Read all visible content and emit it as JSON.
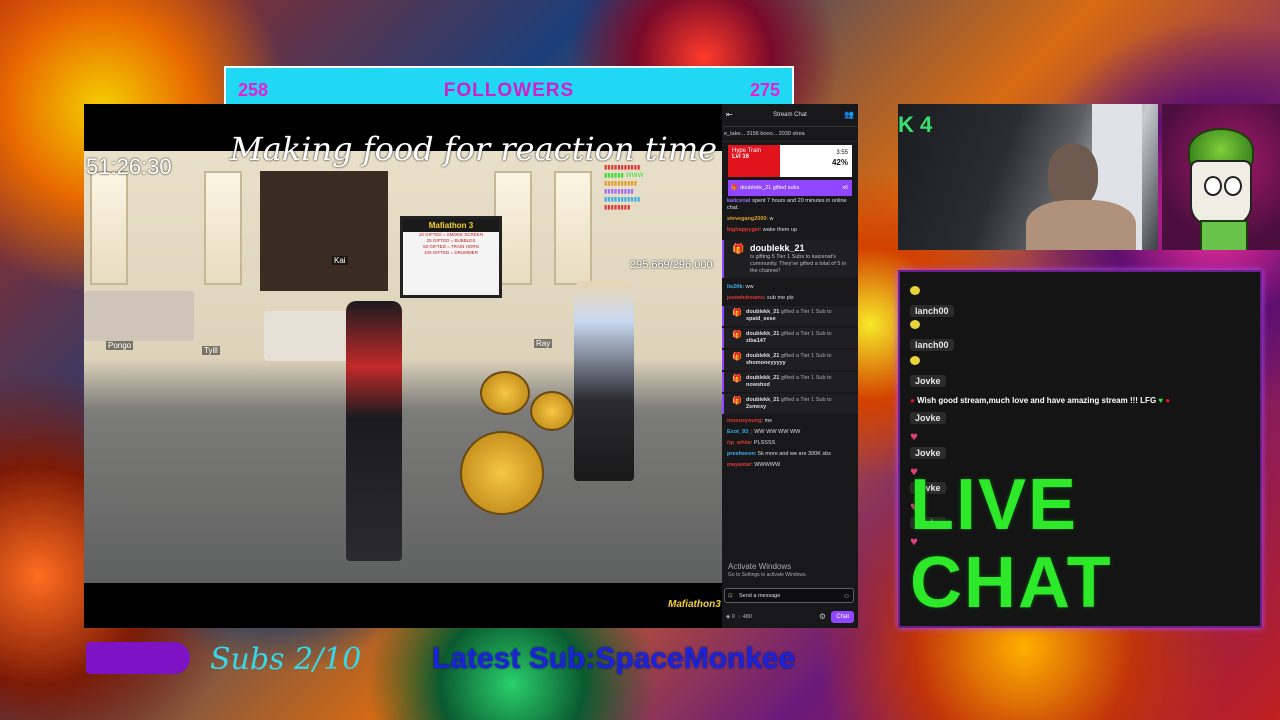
{
  "followers": {
    "current": "258",
    "label": "FOLLOWERS",
    "goal": "275"
  },
  "stream": {
    "title_overlay": "Making food for reaction time",
    "timer": "51:26:30",
    "counter": "295.669/296.000",
    "tv_title": "Mafiathon 3",
    "tv_lines": [
      "10 GIFTED = SMOKE SCREEN",
      "25 GIFTED = BUBBLES",
      "50 GIFTED = TRAIN HORN",
      "100 GIFTED = DRUMMER"
    ],
    "name_tags": [
      "Tyill",
      "Kai",
      "Ray",
      "Pongo"
    ],
    "corner_logo": "Mafiathon3"
  },
  "twitch_chat": {
    "header": "Stream Chat",
    "top_row": "e_take... 3156   booo... 2030   strea",
    "hype_train": {
      "label": "Hype Train",
      "level": "Lvl 16",
      "time": "3:55",
      "percent": "42%"
    },
    "gift_bar": {
      "text": "doublekk_21 gifted subs",
      "count": "x6"
    },
    "messages_top": [
      {
        "user": "kaiicenat",
        "text": "spent 7 hours and 20 minutes in online chat.",
        "color": "#9f6bff"
      },
      {
        "user": "stevegang2000",
        "text": "w",
        "color": "#e0a030"
      },
      {
        "user": "bighappyget",
        "text": "wake them up",
        "color": "#e03838"
      }
    ],
    "big_gift": {
      "user": "doublekk_21",
      "text": "is gifting 5 Tier 1 Subs to kaicenat's community. They've gifted a total of 5 in the channel!"
    },
    "messages_mid": [
      {
        "user": "lix2tlk",
        "text": "ww",
        "color": "#3bb0e8"
      },
      {
        "user": "justwhdreams",
        "text": "sub me pls",
        "color": "#e03838"
      }
    ],
    "gifts": [
      {
        "user": "doublekk_21",
        "text": "gifted a Tier 1 Sub to",
        "target": "spaid_sese"
      },
      {
        "user": "doublekk_21",
        "text": "gifted a Tier 1 Sub to",
        "target": "ziba147"
      },
      {
        "user": "doublekk_21",
        "text": "gifted a Tier 1 Sub to",
        "target": "shomoneyyyyy"
      },
      {
        "user": "doublekk_21",
        "text": "gifted a Tier 1 Sub to",
        "target": "nowshxd"
      },
      {
        "user": "doublekk_21",
        "text": "gifted a Tier 1 Sub to",
        "target": "2smexy"
      }
    ],
    "messages_bottom": [
      {
        "user": "mooneyoung",
        "text": "me",
        "color": "#e03838"
      },
      {
        "user": "Exot_93_",
        "text": "WW WW WW WW",
        "color": "#3bb0e8"
      },
      {
        "user": "rip_whiie",
        "text": "PLSSSS",
        "color": "#e03838"
      },
      {
        "user": "presheeon",
        "text": "5k more and we are 300K sbs",
        "color": "#3bb0e8"
      },
      {
        "user": "mayastar",
        "text": "WWWWW",
        "color": "#e03838"
      }
    ],
    "activate": {
      "title": "Activate Windows",
      "sub": "Go to Settings to activate Windows."
    },
    "input_placeholder": "Send a message",
    "points": "0",
    "points2": "480",
    "chat_button": "Chat"
  },
  "webcam": {
    "badge": "K 4"
  },
  "live_chat": {
    "items": [
      {
        "name": "lanch00"
      },
      {
        "name": "lanch00"
      },
      {
        "name": "Jovke",
        "text": "Wish good stream,much love and have amazing stream !!! LFG"
      },
      {
        "name": "Jovke"
      },
      {
        "name": "Jovke"
      },
      {
        "name": "Jovke"
      },
      {
        "name": "Jovke"
      }
    ],
    "title": "LIVE CHAT"
  },
  "bottom": {
    "subs": "Subs 2/10",
    "latest_sub": "Latest Sub:SpaceMonkee"
  },
  "colors": {
    "followers_bg": "#21d8f4",
    "followers_text": "#e81fd3",
    "twitch_purple": "#9147ff",
    "live_chat_green": "#2ee82a",
    "subs_text": "#37d7e8",
    "latest_sub_text": "#1b23d6"
  }
}
